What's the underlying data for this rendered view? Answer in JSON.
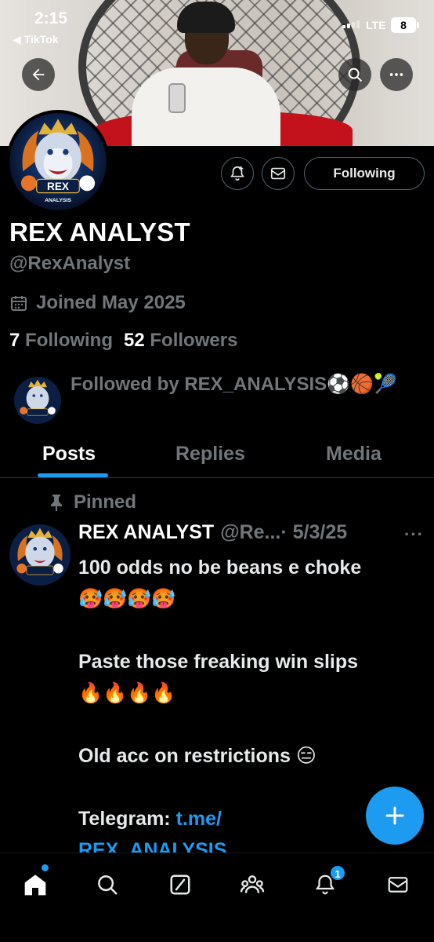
{
  "status_bar": {
    "time": "2:15",
    "back_app": "◀ TikTok",
    "network": "LTE",
    "battery": "8"
  },
  "profile": {
    "display_name": "REX ANALYST",
    "handle": "@RexAnalyst",
    "joined": "Joined May 2025",
    "following_count": "7",
    "following_label": "Following",
    "followers_count": "52",
    "followers_label": "Followers",
    "followed_by": "Followed by REX_ANALYSIS⚽🏀🎾",
    "follow_button_label": "Following",
    "logo_text": "REX",
    "logo_subtext": "ANALYSIS"
  },
  "tabs": [
    {
      "label": "Posts",
      "active": true
    },
    {
      "label": "Replies",
      "active": false
    },
    {
      "label": "Media",
      "active": false
    }
  ],
  "pinned_post": {
    "pinned_label": "Pinned",
    "author_name": "REX ANALYST",
    "author_handle": "@Re...",
    "date": "· 5/3/25",
    "more": "···",
    "lines": [
      "100 odds no be beans e choke",
      "🥵🥵🥵🥵",
      "",
      "Paste those freaking win slips",
      "🔥🔥🔥🔥",
      "",
      "Old acc on restrictions 😑",
      "",
      "Telegram: ",
      "REX_ANALYSIS"
    ],
    "link_start": "t.me/"
  },
  "bottom_nav": {
    "notifications_badge": "1"
  },
  "colors": {
    "accent": "#1d9bf0",
    "muted_text": "#71767b",
    "background": "#000000"
  }
}
